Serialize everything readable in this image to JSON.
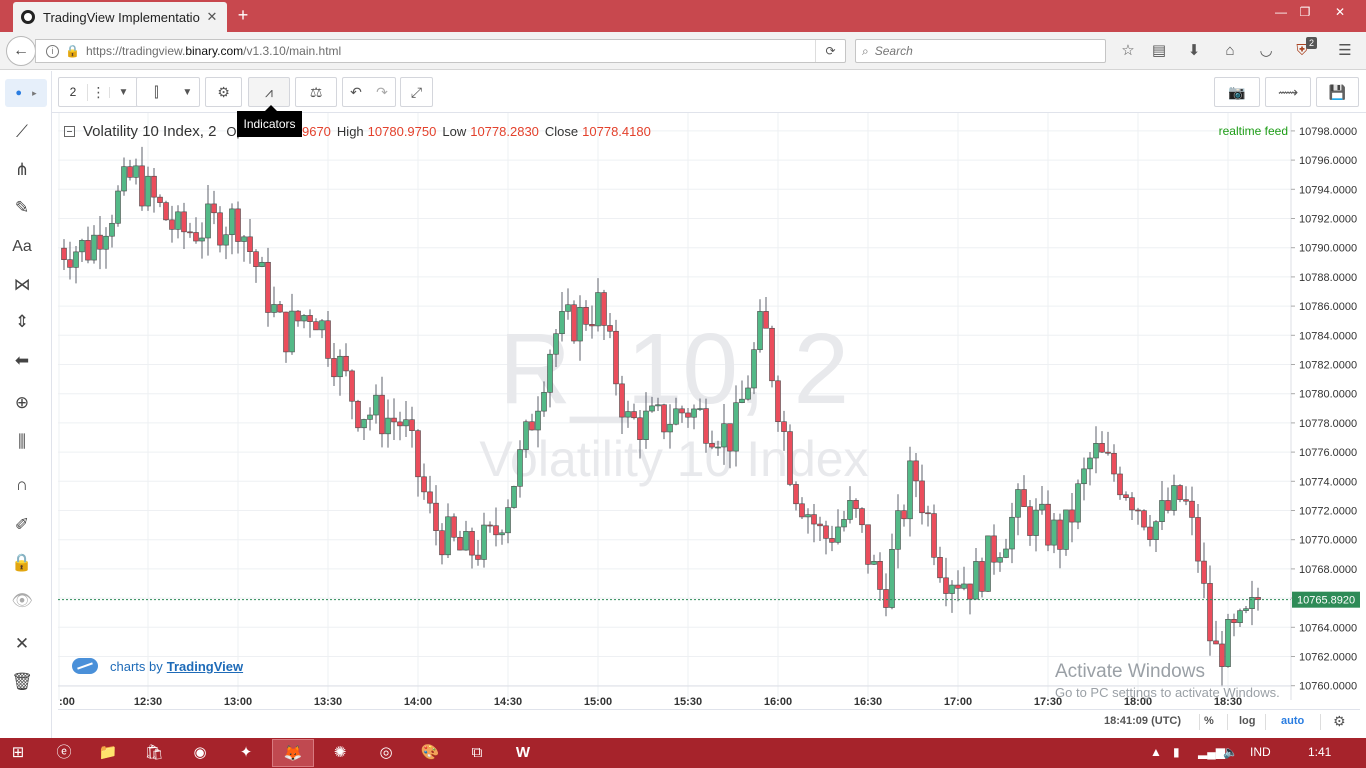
{
  "browser": {
    "tab_title": "TradingView Implementatio",
    "close_glyph": "✕",
    "new_tab_glyph": "+",
    "url_prefix": "https://tradingview.",
    "url_domain": "binary.com",
    "url_path": "/v1.3.10/main.html",
    "search_placeholder": "Search",
    "badge_count": "2",
    "icons": [
      "info-icon",
      "lock-icon",
      "reload-icon",
      "search-icon",
      "bookmark-star-icon",
      "reading-list-icon",
      "download-icon",
      "home-icon",
      "pocket-icon",
      "ublock-icon",
      "menu-icon"
    ]
  },
  "toolbar": {
    "interval": "2",
    "tooltip": "Indicators"
  },
  "legend": {
    "symbol": "Volatility 10 Index, 2",
    "open_label": "Open",
    "open_value": "10780.9670",
    "high_label": "High",
    "high_value": "10780.9750",
    "low_label": "Low",
    "low_value": "10778.2830",
    "close_label": "Close",
    "close_value": "10778.4180"
  },
  "chart": {
    "watermark_line1": "R_10, 2",
    "watermark_line2": "Volatility 10 Index",
    "realtime_label": "realtime feed",
    "last_price": "10765.8920",
    "branding_prefix": "charts by",
    "branding_link": "TradingView",
    "clock": "18:41:09 (UTC)",
    "percent_btn": "%",
    "log_btn": "log",
    "auto_btn": "auto"
  },
  "chart_data": {
    "type": "candlestick",
    "y_ticks": [
      "10798.0000",
      "10796.0000",
      "10794.0000",
      "10792.0000",
      "10790.0000",
      "10788.0000",
      "10786.0000",
      "10784.0000",
      "10782.0000",
      "10780.0000",
      "10778.0000",
      "10776.0000",
      "10774.0000",
      "10772.0000",
      "10770.0000",
      "10768.0000",
      "10766.0000",
      "10764.0000",
      "10762.0000",
      "10760.0000"
    ],
    "ylim": [
      10760,
      10798
    ],
    "x_ticks": [
      ":00",
      "12:30",
      "13:00",
      "13:30",
      "14:00",
      "14:30",
      "15:00",
      "15:30",
      "16:00",
      "16:30",
      "17:00",
      "17:30",
      "18:00",
      "18:30"
    ],
    "up_color": "#53b987",
    "down_color": "#eb4d5c",
    "price_line": 10765.892,
    "ohlc_key_points": [
      {
        "time": "12:10",
        "close": 10790
      },
      {
        "time": "12:25",
        "close": 10795
      },
      {
        "time": "12:40",
        "close": 10791
      },
      {
        "time": "13:00",
        "close": 10792
      },
      {
        "time": "13:15",
        "close": 10784
      },
      {
        "time": "13:25",
        "close": 10786
      },
      {
        "time": "13:40",
        "close": 10779
      },
      {
        "time": "13:55",
        "close": 10778
      },
      {
        "time": "14:05",
        "close": 10771
      },
      {
        "time": "14:15",
        "close": 10769
      },
      {
        "time": "14:25",
        "close": 10770
      },
      {
        "time": "14:35",
        "close": 10776
      },
      {
        "time": "14:45",
        "close": 10784
      },
      {
        "time": "15:00",
        "close": 10786
      },
      {
        "time": "15:10",
        "close": 10778
      },
      {
        "time": "15:20",
        "close": 10778
      },
      {
        "time": "15:30",
        "close": 10779
      },
      {
        "time": "15:45",
        "close": 10777
      },
      {
        "time": "15:55",
        "close": 10785
      },
      {
        "time": "16:05",
        "close": 10774
      },
      {
        "time": "16:15",
        "close": 10770
      },
      {
        "time": "16:25",
        "close": 10772
      },
      {
        "time": "16:35",
        "close": 10766
      },
      {
        "time": "16:45",
        "close": 10775
      },
      {
        "time": "16:55",
        "close": 10768
      },
      {
        "time": "17:05",
        "close": 10767
      },
      {
        "time": "17:20",
        "close": 10772
      },
      {
        "time": "17:35",
        "close": 10770
      },
      {
        "time": "17:45",
        "close": 10776
      },
      {
        "time": "17:55",
        "close": 10774
      },
      {
        "time": "18:05",
        "close": 10771
      },
      {
        "time": "18:15",
        "close": 10773
      },
      {
        "time": "18:20",
        "close": 10769
      },
      {
        "time": "18:25",
        "close": 10762
      },
      {
        "time": "18:35",
        "close": 10764
      },
      {
        "time": "18:41",
        "close": 10765.892
      }
    ]
  },
  "taskbar": {
    "lang": "IND",
    "time": "1:41"
  }
}
